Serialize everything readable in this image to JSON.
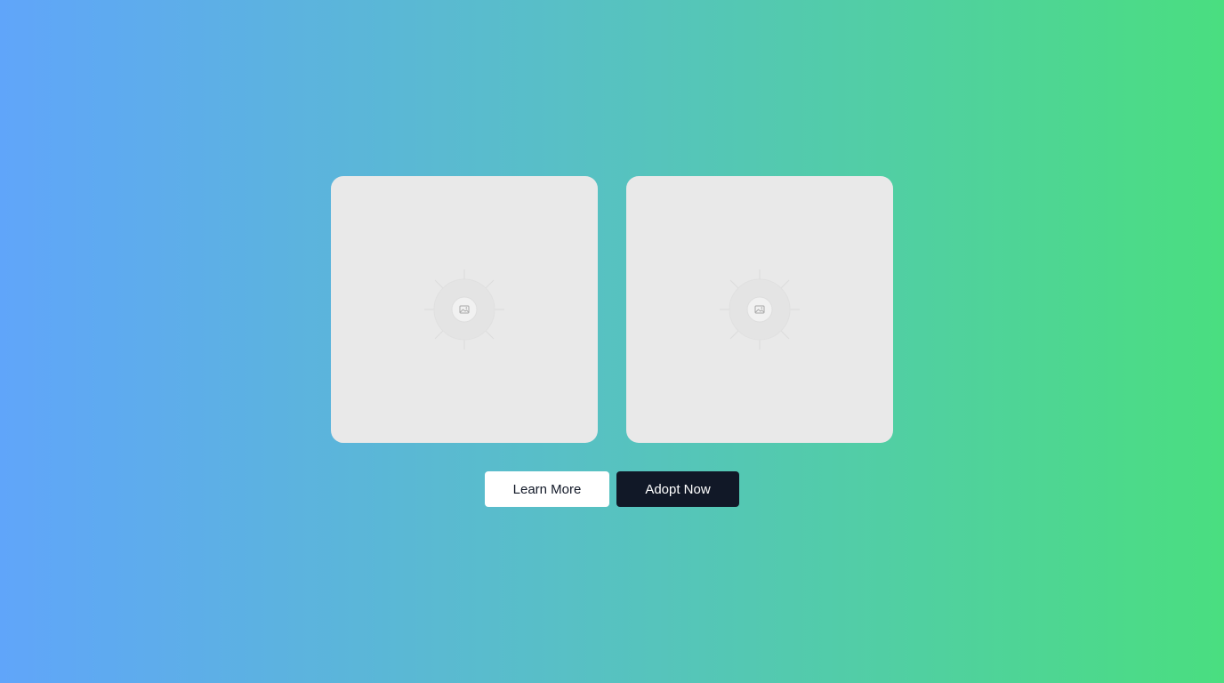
{
  "cards": [
    {
      "icon": "image-placeholder-icon"
    },
    {
      "icon": "image-placeholder-icon"
    }
  ],
  "actions": {
    "learn_more_label": "Learn More",
    "adopt_now_label": "Adopt Now"
  },
  "colors": {
    "gradient_start": "#60a5fa",
    "gradient_end": "#4ade80",
    "card_bg": "#e9e9e9",
    "primary_button_bg": "#111827",
    "secondary_button_bg": "#ffffff"
  }
}
